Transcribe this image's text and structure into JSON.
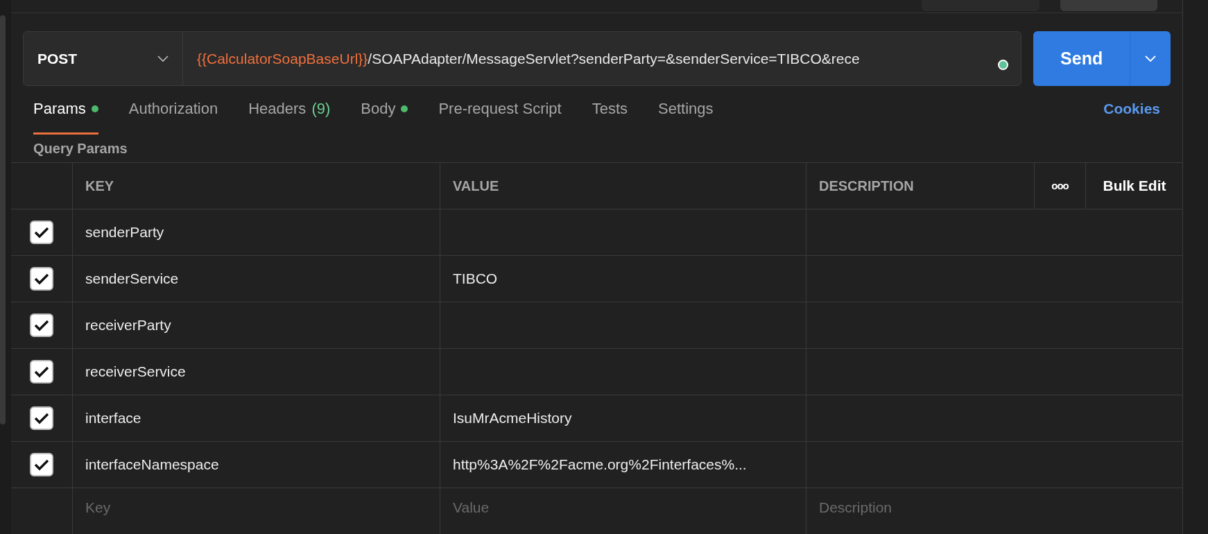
{
  "request": {
    "method": "POST",
    "url_variable": "{{CalculatorSoapBaseUrl}}",
    "url_path": "/SOAPAdapter/MessageServlet?senderParty=&senderService=TIBCO&rece",
    "send_label": "Send"
  },
  "tabs": [
    {
      "label": "Params",
      "dot": true,
      "selected": true
    },
    {
      "label": "Authorization",
      "dot": false,
      "selected": false
    },
    {
      "label": "Headers",
      "dot": false,
      "count": "(9)",
      "selected": false
    },
    {
      "label": "Body",
      "dot": true,
      "selected": false
    },
    {
      "label": "Pre-request Script",
      "dot": false,
      "selected": false
    },
    {
      "label": "Tests",
      "dot": false,
      "selected": false
    },
    {
      "label": "Settings",
      "dot": false,
      "selected": false
    }
  ],
  "cookies_link": "Cookies",
  "section_title": "Query Params",
  "table": {
    "columns": [
      "KEY",
      "VALUE",
      "DESCRIPTION"
    ],
    "more_label": "ooo",
    "bulk_edit": "Bulk Edit",
    "rows": [
      {
        "checked": true,
        "key": "senderParty"
      },
      {
        "checked": true,
        "key": "senderService",
        "value": "TIBCO"
      },
      {
        "checked": true,
        "key": "receiverParty"
      },
      {
        "checked": true,
        "key": "receiverService"
      },
      {
        "checked": true,
        "key": "interface",
        "value": "IsuMrAcmeHistory"
      },
      {
        "checked": true,
        "key": "interfaceNamespace",
        "value": "http%3A%2F%2Facme.org%2Finterfaces%..."
      }
    ],
    "new_row": {
      "key_placeholder": "Key",
      "value_placeholder": "Value",
      "description_placeholder": "Description"
    }
  }
}
